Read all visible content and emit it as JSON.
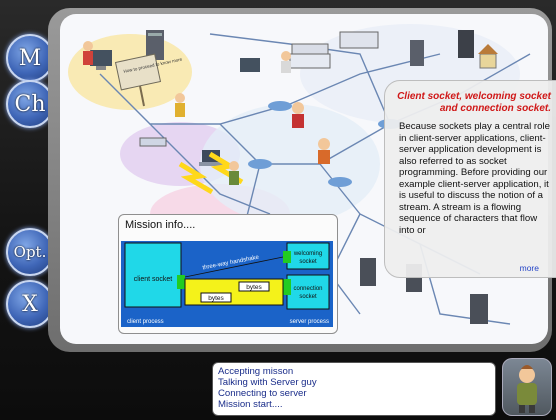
{
  "sidebar": {
    "buttons": [
      {
        "label": "M"
      },
      {
        "label": "Ch"
      },
      {
        "label": "Opt."
      },
      {
        "label": "X"
      }
    ]
  },
  "scene": {
    "sign_text": "How to proceed to know more"
  },
  "info_panel": {
    "title": "Client socket, welcoming socket and connection socket.",
    "body": "Because sockets play a central role in client-server applications, client-server application development is also referred to as socket programming. Before providing our example client-server application, it is useful to discuss the notion of a stream. A stream is a flowing sequence of characters that flow into or",
    "more_label": "more"
  },
  "mission": {
    "title": "Mission info....",
    "diagram": {
      "client_socket": "client socket",
      "welcoming_socket": "welcoming socket",
      "connection_socket": "connection socket",
      "handshake": "three-way handshake",
      "bytes_top": "bytes",
      "bytes_bottom": "bytes",
      "client_process": "client process",
      "server_process": "server process"
    }
  },
  "status": {
    "lines": [
      "Accepting misson",
      "Talking with Server guy",
      "Connecting to server",
      "Mission start...."
    ]
  },
  "colors": {
    "info_title": "#d01818",
    "status_text": "#1a2d8a",
    "socket_fill": "#20d8e8",
    "link_green": "#22cc22",
    "link_yellow": "#f4f21a"
  }
}
